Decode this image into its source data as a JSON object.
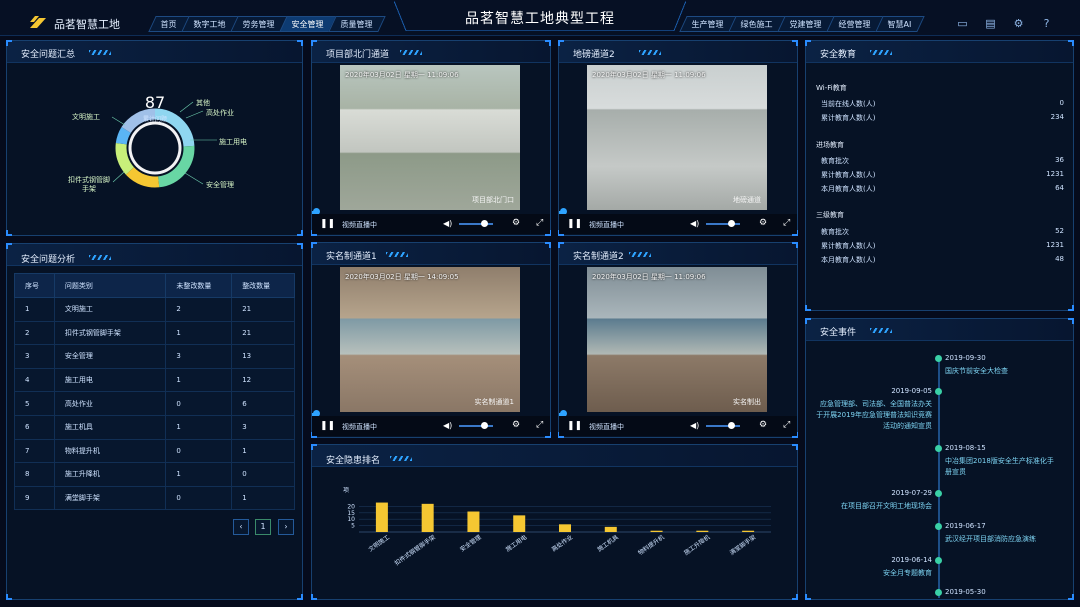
{
  "header": {
    "brand": "品茗智慧工地",
    "title": "品茗智慧工地典型工程",
    "nav_left": [
      "首页",
      "数字工地",
      "劳务管理",
      "安全管理",
      "质量管理"
    ],
    "nav_left_active": 3,
    "nav_right": [
      "生产管理",
      "绿色施工",
      "党建管理",
      "经营管理",
      "智慧AI"
    ],
    "tool_icons": [
      "monitor-icon",
      "document-icon",
      "gear-icon",
      "help-icon"
    ]
  },
  "safety_summary": {
    "title": "安全问题汇总",
    "total": "87",
    "total_label": "累计问题",
    "segments": [
      {
        "name": "文明施工",
        "value": 21,
        "color": "#8fd6f0"
      },
      {
        "name": "扣件式钢管脚手架",
        "value": 21,
        "color": "#68d6a4"
      },
      {
        "name": "安全管理",
        "value": 13,
        "color": "#f5c732"
      },
      {
        "name": "施工用电",
        "value": 12,
        "color": "#c8ef7a"
      },
      {
        "name": "高处作业",
        "value": 6,
        "color": "#5ab5f5"
      },
      {
        "name": "其他",
        "value": 14,
        "color": "#a0c0e8"
      }
    ],
    "labels": [
      "文明施工",
      "其他",
      "高处作业",
      "施工用电",
      "安全管理",
      "扣件式钢管脚手架"
    ]
  },
  "analysis": {
    "title": "安全问题分析",
    "columns": [
      "序号",
      "问题类别",
      "未整改数量",
      "整改数量"
    ],
    "rows": [
      [
        "1",
        "文明施工",
        "2",
        "21"
      ],
      [
        "2",
        "扣件式钢管脚手架",
        "1",
        "21"
      ],
      [
        "3",
        "安全管理",
        "3",
        "13"
      ],
      [
        "4",
        "施工用电",
        "1",
        "12"
      ],
      [
        "5",
        "高处作业",
        "0",
        "6"
      ],
      [
        "6",
        "施工机具",
        "1",
        "3"
      ],
      [
        "7",
        "物料提升机",
        "0",
        "1"
      ],
      [
        "8",
        "施工升降机",
        "1",
        "0"
      ],
      [
        "9",
        "满堂脚手架",
        "0",
        "1"
      ]
    ],
    "pager_prev": "‹",
    "pager_page": "1",
    "pager_next": "›"
  },
  "videos": [
    {
      "title": "项目部北门通道",
      "timestamp": "2020年03月02日  星期一  11:09:06",
      "cam": "项目部北门口",
      "status": "视频直播中"
    },
    {
      "title": "地磅通道2",
      "timestamp": "2020年03月02日  星期一  11:09:06",
      "cam": "地磅通道",
      "status": "视频直播中"
    },
    {
      "title": "实名制通道1",
      "timestamp": "2020年03月02日  星期一  14:09:05",
      "cam": "实名制通道1",
      "status": "视频直播中"
    },
    {
      "title": "实名制通道2",
      "timestamp": "2020年03月02日  星期一  11:09:06",
      "cam": "实名制出",
      "status": "视频直播中"
    }
  ],
  "ranking": {
    "title": "安全隐患排名",
    "chart_data": {
      "type": "bar",
      "y_unit": "项",
      "categories": [
        "文明施工",
        "扣件式钢管脚手架",
        "安全管理",
        "施工用电",
        "高处作业",
        "施工机具",
        "物料提升机",
        "施工升降机",
        "满堂脚手架"
      ],
      "values": [
        23,
        22,
        16,
        13,
        6,
        4,
        1,
        1,
        1
      ],
      "yticks": [
        "20",
        "15",
        "10",
        "5"
      ],
      "ylim": [
        0,
        25
      ],
      "color": "#f5c732"
    }
  },
  "education": {
    "title": "安全教育",
    "groups": [
      {
        "heading": "Wi-Fi教育",
        "rows": [
          [
            "当前在线人数(人)",
            "0"
          ],
          [
            "累计教育人数(人)",
            "234"
          ]
        ]
      },
      {
        "heading": "进场教育",
        "rows": [
          [
            "教育批次",
            "36"
          ],
          [
            "累计教育人数(人)",
            "1231"
          ],
          [
            "本月教育人数(人)",
            "64"
          ]
        ]
      },
      {
        "heading": "三级教育",
        "rows": [
          [
            "教育批次",
            "52"
          ],
          [
            "累计教育人数(人)",
            "1231"
          ],
          [
            "本月教育人数(人)",
            "48"
          ]
        ]
      }
    ]
  },
  "events": {
    "title": "安全事件",
    "items": [
      {
        "date": "2019-09-30",
        "desc": "国庆节前安全大检查",
        "side": "right"
      },
      {
        "date": "2019-09-05",
        "desc": "应急管理部、司法部、全国普法办关于开展2019年应急管理普法知识竞赛活动的通知宣贯",
        "side": "left"
      },
      {
        "date": "2019-08-15",
        "desc": "中冶集团2018版安全生产标准化手册宣贯",
        "side": "right"
      },
      {
        "date": "2019-07-29",
        "desc": "在项目部召开文明工地现场会",
        "side": "left"
      },
      {
        "date": "2019-06-17",
        "desc": "武汉经开项目部消防应急演练",
        "side": "right"
      },
      {
        "date": "2019-06-14",
        "desc": "安全月专题教育",
        "side": "left"
      },
      {
        "date": "2019-05-30",
        "desc": "",
        "side": "right"
      }
    ]
  }
}
